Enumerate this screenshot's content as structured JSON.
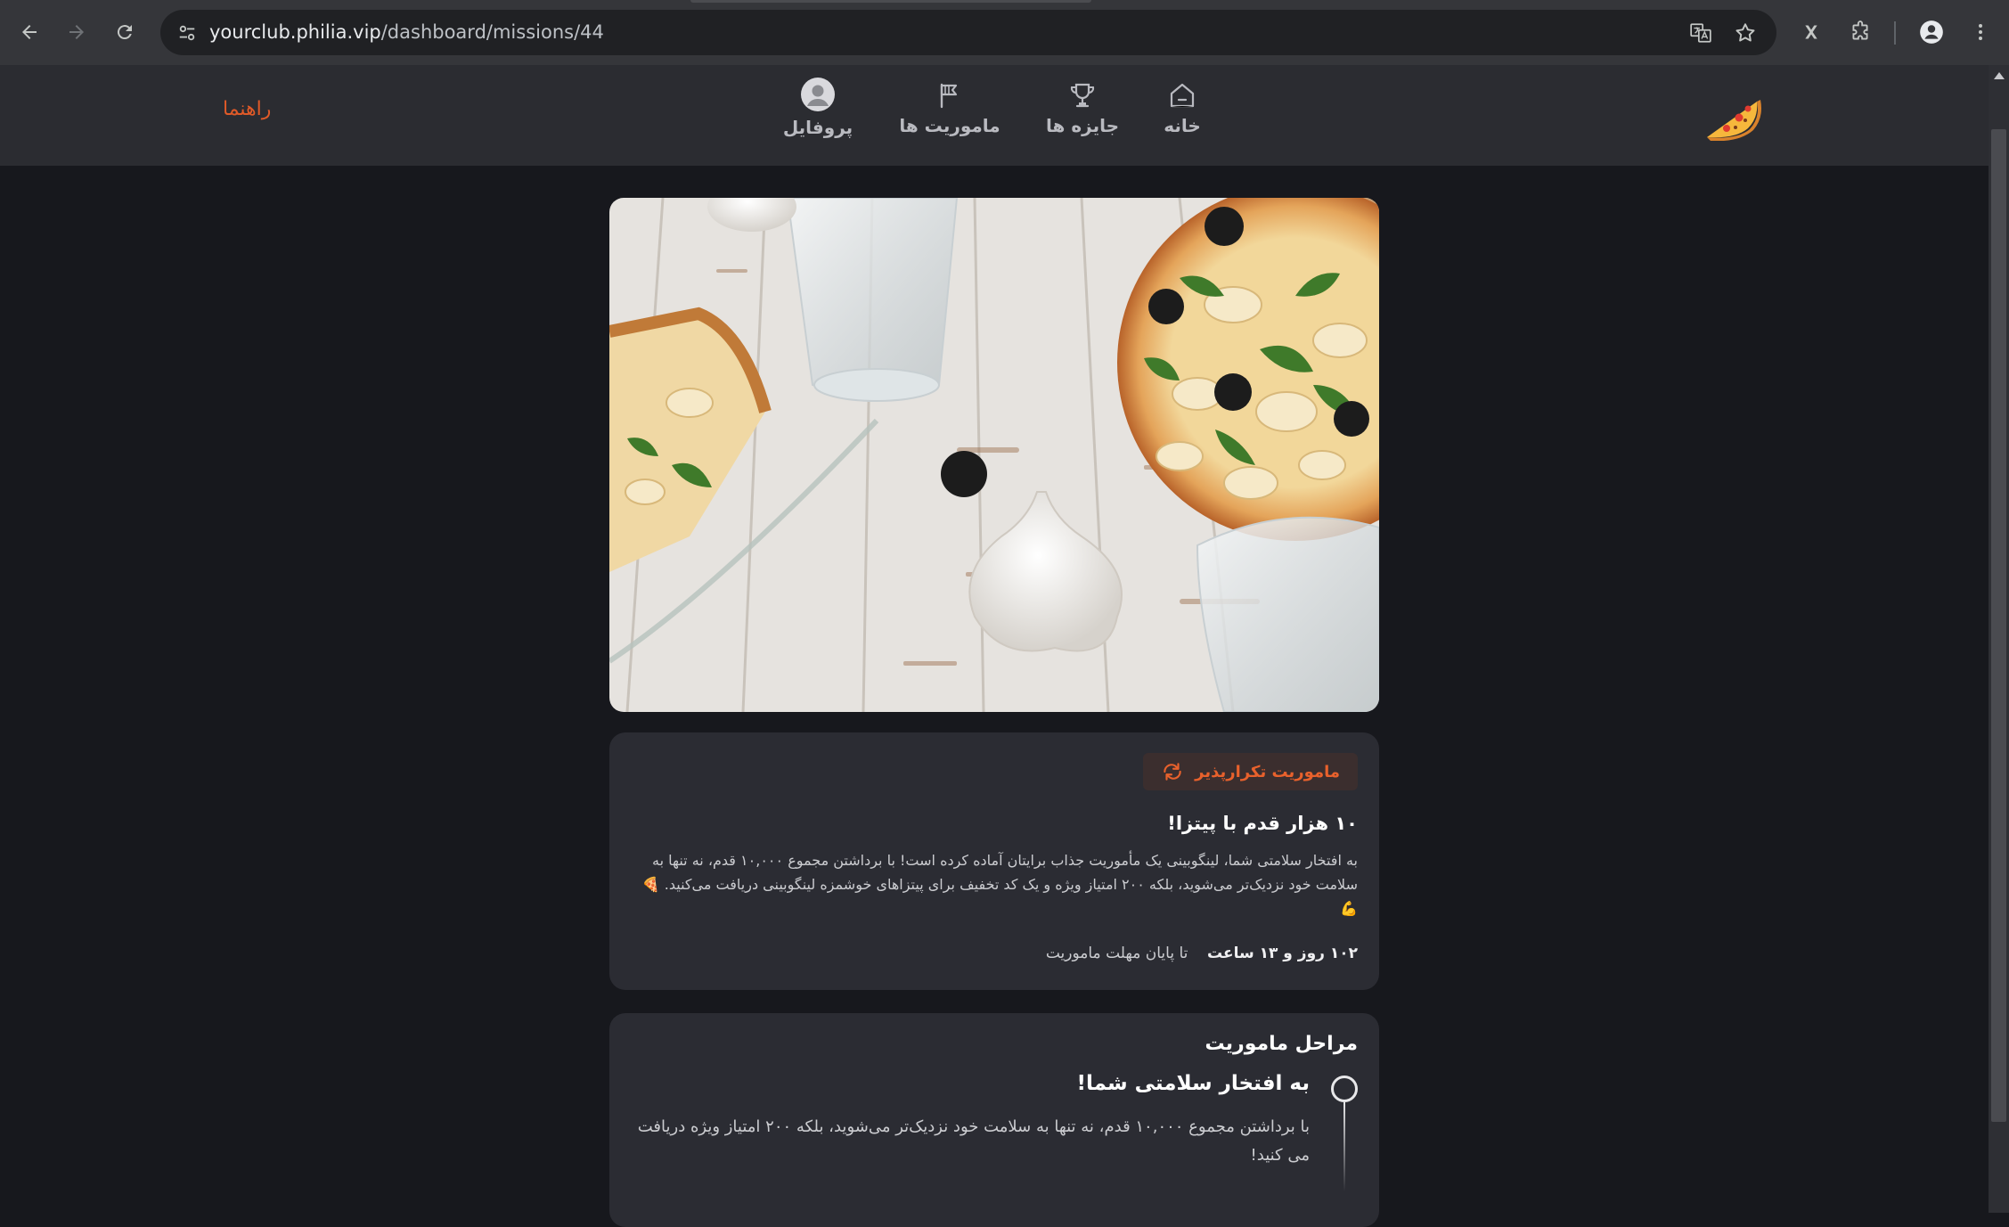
{
  "browser": {
    "url_host": "yourclub.philia.vip",
    "url_path": "/dashboard/missions/44"
  },
  "nav": {
    "home": "خانه",
    "prizes": "جایزه ها",
    "missions": "ماموریت ها",
    "profile": "پروفایل",
    "guide": "راهنما"
  },
  "mission": {
    "badge": "ماموریت تکرارپذیر",
    "title": "۱۰ هزار قدم با پیتزا!",
    "description": "به افتخار سلامتی شما، لینگوبینی یک مأموریت جذاب برایتان آماده کرده است! با برداشتن مجموع ۱۰,۰۰۰ قدم، نه تنها به سلامت خود نزدیک‌تر می‌شوید، بلکه ۲۰۰ امتیاز ویژه و یک کد تخفیف برای پیتزاهای خوشمزه لینگوبینی دریافت می‌کنید. 🍕 💪",
    "deadline_value": "۱۰۲ روز و ۱۳ ساعت",
    "deadline_text": "تا پایان مهلت ماموریت"
  },
  "steps": {
    "title": "مراحل ماموریت",
    "items": [
      {
        "title": "به افتخار سلامتی شما!",
        "description": "با برداشتن مجموع ۱۰,۰۰۰ قدم، نه تنها به سلامت خود نزدیک‌تر می‌شوید، بلکه ۲۰۰ امتیاز ویژه دریافت می کنید!"
      }
    ]
  },
  "colors": {
    "accent": "#e05a28",
    "page_bg": "#17181d",
    "header_bg": "#2b2c31",
    "card_bg": "#2b2c33"
  }
}
